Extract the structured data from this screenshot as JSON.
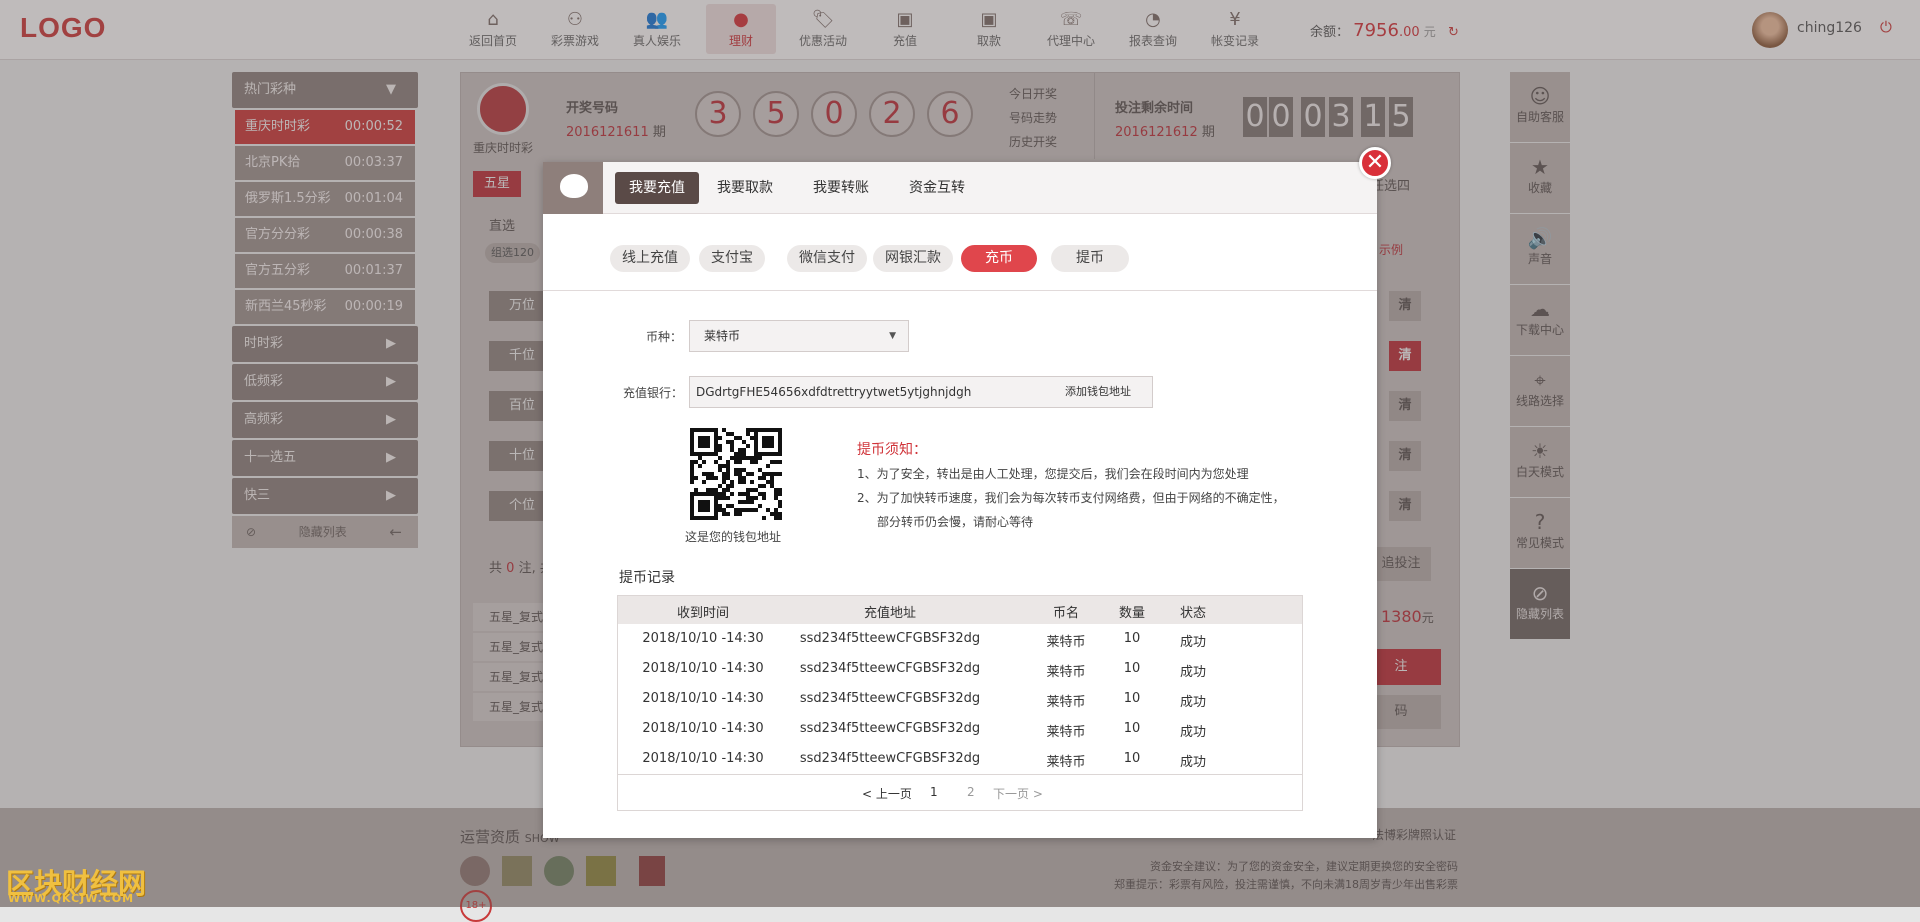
{
  "header": {
    "logo": "LOGO",
    "nav": [
      {
        "label": "返回首页",
        "icon": "home-icon",
        "glyph": "⌂"
      },
      {
        "label": "彩票游戏",
        "icon": "lottery-balls-icon",
        "glyph": "⚇"
      },
      {
        "label": "真人娱乐",
        "icon": "people-icon",
        "glyph": "👥"
      },
      {
        "label": "理财",
        "icon": "piggy-bank-icon",
        "glyph": "●",
        "active": true
      },
      {
        "label": "优惠活动",
        "icon": "tag-icon",
        "glyph": "🏷"
      },
      {
        "label": "充值",
        "icon": "wallet-in-icon",
        "glyph": "▣"
      },
      {
        "label": "取款",
        "icon": "wallet-out-icon",
        "glyph": "▣"
      },
      {
        "label": "代理中心",
        "icon": "agent-icon",
        "glyph": "☏"
      },
      {
        "label": "报表查询",
        "icon": "pie-chart-icon",
        "glyph": "◔"
      },
      {
        "label": "帐变记录",
        "icon": "yen-icon",
        "glyph": "¥"
      }
    ],
    "balance_label": "余额：",
    "balance_int": "7956",
    "balance_dec": ".00",
    "balance_unit": "元",
    "refresh_icon": "↻",
    "username": "ching126",
    "power_icon": "⏻"
  },
  "left": {
    "hot_title": "热门彩种",
    "hot_arrow": "▼",
    "lotteries": [
      {
        "name": "重庆时时彩",
        "time": "00:00:52",
        "active": true
      },
      {
        "name": "北京PK拾",
        "time": "00:03:37"
      },
      {
        "name": "俄罗斯1.5分彩",
        "time": "00:01:04"
      },
      {
        "name": "官方分分彩",
        "time": "00:00:38"
      },
      {
        "name": "官方五分彩",
        "time": "00:01:37"
      },
      {
        "name": "新西兰45秒彩",
        "time": "00:00:19"
      }
    ],
    "categories": [
      "时时彩",
      "低频彩",
      "高频彩",
      "十一选五",
      "快三"
    ],
    "cat_arrow": "▶",
    "hide_label": "隐藏列表",
    "hide_arrow": "←"
  },
  "main": {
    "lottery_name": "重庆时时彩",
    "draw_label": "开奖号码",
    "draw_issue": "2016121611",
    "issue_unit": "期",
    "balls": [
      "3",
      "5",
      "0",
      "2",
      "6"
    ],
    "links": [
      "今日开奖",
      "号码走势",
      "历史开奖"
    ],
    "remain_label": "投注剩余时间",
    "remain_issue": "2016121612",
    "countdown": [
      "0",
      "0",
      "0",
      "3",
      "1",
      "5"
    ],
    "five_star": "五星",
    "direct": "直选",
    "group120": "组选120",
    "positions": [
      "万位",
      "千位",
      "百位",
      "十位",
      "个位"
    ],
    "clear": "清",
    "any_four": "任选四",
    "example": "示例",
    "total_prefix": "共",
    "total_count": "0",
    "total_suffix": "注, 共",
    "records": [
      "五星_复式",
      "五星_复式",
      "五星_复式",
      "五星_复式"
    ],
    "amount": "1380",
    "amount_unit": "元",
    "chase": "追投注",
    "bet": "注",
    "code": "码"
  },
  "right": [
    {
      "label": "自助客服",
      "icon": "support-icon",
      "glyph": "☺"
    },
    {
      "label": "收藏",
      "icon": "star-icon",
      "glyph": "★"
    },
    {
      "label": "声音",
      "icon": "speaker-icon",
      "glyph": "🔊"
    },
    {
      "label": "下载中心",
      "icon": "cloud-download-icon",
      "glyph": "☁"
    },
    {
      "label": "线路选择",
      "icon": "route-icon",
      "glyph": "⌖"
    },
    {
      "label": "白天模式",
      "icon": "sun-icon",
      "glyph": "☀"
    },
    {
      "label": "常见模式",
      "icon": "question-icon",
      "glyph": "?"
    },
    {
      "label": "隐藏列表",
      "icon": "eye-slash-icon",
      "glyph": "⊘",
      "dark": true
    }
  ],
  "footer": {
    "qual": "运营资质",
    "qual_suffix": "SHOW",
    "cert": "法博彩牌照认证",
    "tip1": "资金安全建议：为了您的资金安全，建议定期更换您的安全密码",
    "tip2": "郑重提示：彩票有风险，投注需谨慎，不向未满18周岁青少年出售彩票",
    "age": "18+"
  },
  "modal": {
    "tabs": [
      "我要充值",
      "我要取款",
      "我要转账",
      "资金互转"
    ],
    "active_tab": 0,
    "close": "✕",
    "subtabs": [
      "线上充值",
      "支付宝",
      "微信支付",
      "网银汇款",
      "充币",
      "提币"
    ],
    "active_subtab": 4,
    "coin_label": "币种：",
    "coin_value": "莱特币",
    "caret": "▼",
    "bank_label": "充值银行：",
    "wallet_address": "DGdrtgFHE54656xdfdtrettryytwet5ytjghnjdgh",
    "add_wallet": "添加钱包地址",
    "qr_caption": "这是您的钱包地址",
    "notice_title": "提币须知：",
    "notice_lines": [
      "1、为了安全，转出是由人工处理，您提交后，我们会在段时间内为您处理",
      "2、为了加快转币速度，我们会为每次转币支付网络费，但由于网络的不确定性，",
      "部分转币仍会慢，请耐心等待"
    ],
    "records_title": "提币记录",
    "columns": [
      "收到时间",
      "充值地址",
      "币名",
      "数量",
      "状态"
    ],
    "rows": [
      [
        "2018/10/10 -14:30",
        "ssd234f5tteewCFGBSF32dg",
        "莱特币",
        "10",
        "成功"
      ],
      [
        "2018/10/10 -14:30",
        "ssd234f5tteewCFGBSF32dg",
        "莱特币",
        "10",
        "成功"
      ],
      [
        "2018/10/10 -14:30",
        "ssd234f5tteewCFGBSF32dg",
        "莱特币",
        "10",
        "成功"
      ],
      [
        "2018/10/10 -14:30",
        "ssd234f5tteewCFGBSF32dg",
        "莱特币",
        "10",
        "成功"
      ],
      [
        "2018/10/10 -14:30",
        "ssd234f5tteewCFGBSF32dg",
        "莱特币",
        "10",
        "成功"
      ]
    ],
    "pager": {
      "prev": "< 上一页",
      "pages": [
        "1",
        "2"
      ],
      "next": "下一页 >"
    }
  },
  "watermark": {
    "text": "区块财经网",
    "url": "WWW.QKCJW.COM"
  },
  "colors": {
    "accent": "#d0343a",
    "dark_tab": "#5a4a47"
  }
}
